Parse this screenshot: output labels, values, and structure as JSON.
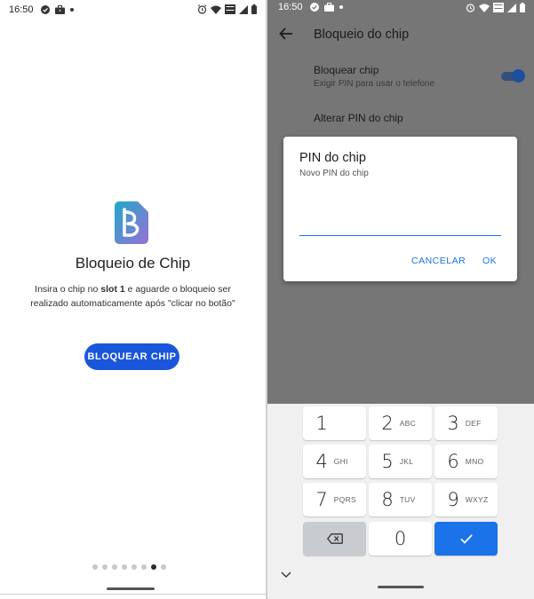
{
  "left_screen": {
    "status": {
      "time": "16:50"
    },
    "welcome": {
      "title": "Bloqueio de Chip",
      "desc_pre": "Insira o chip no ",
      "desc_bold": "slot 1",
      "desc_post": " e aguarde o bloqueio ser realizado automaticamente após \"clicar no botão\""
    },
    "button_label": "BLOQUEAR CHIP",
    "pager": {
      "count": 8,
      "active_index": 6
    }
  },
  "right_screen": {
    "status": {
      "time": "16:50"
    },
    "appbar": {
      "title": "Bloqueio do chip"
    },
    "preferences": [
      {
        "title": "Bloquear chip",
        "summary": "Exigir PIN para usar o telefone",
        "enabled": true
      },
      {
        "title": "Alterar PIN do chip"
      }
    ],
    "dialog": {
      "title": "PIN do chip",
      "subtitle": "Novo PIN do chip",
      "value": "",
      "cancel": "CANCELAR",
      "ok": "OK"
    },
    "keypad": {
      "keys": [
        {
          "num": "1",
          "letters": ""
        },
        {
          "num": "2",
          "letters": "ABC"
        },
        {
          "num": "3",
          "letters": "DEF"
        },
        {
          "num": "4",
          "letters": "GHI"
        },
        {
          "num": "5",
          "letters": "JKL"
        },
        {
          "num": "6",
          "letters": "MNO"
        },
        {
          "num": "7",
          "letters": "PQRS"
        },
        {
          "num": "8",
          "letters": "TUV"
        },
        {
          "num": "9",
          "letters": "WXYZ"
        },
        {
          "num": "0",
          "letters": ""
        }
      ]
    }
  },
  "colors": {
    "primary": "#1a56db",
    "accent": "#1a73e8",
    "scrim": "#767676"
  }
}
